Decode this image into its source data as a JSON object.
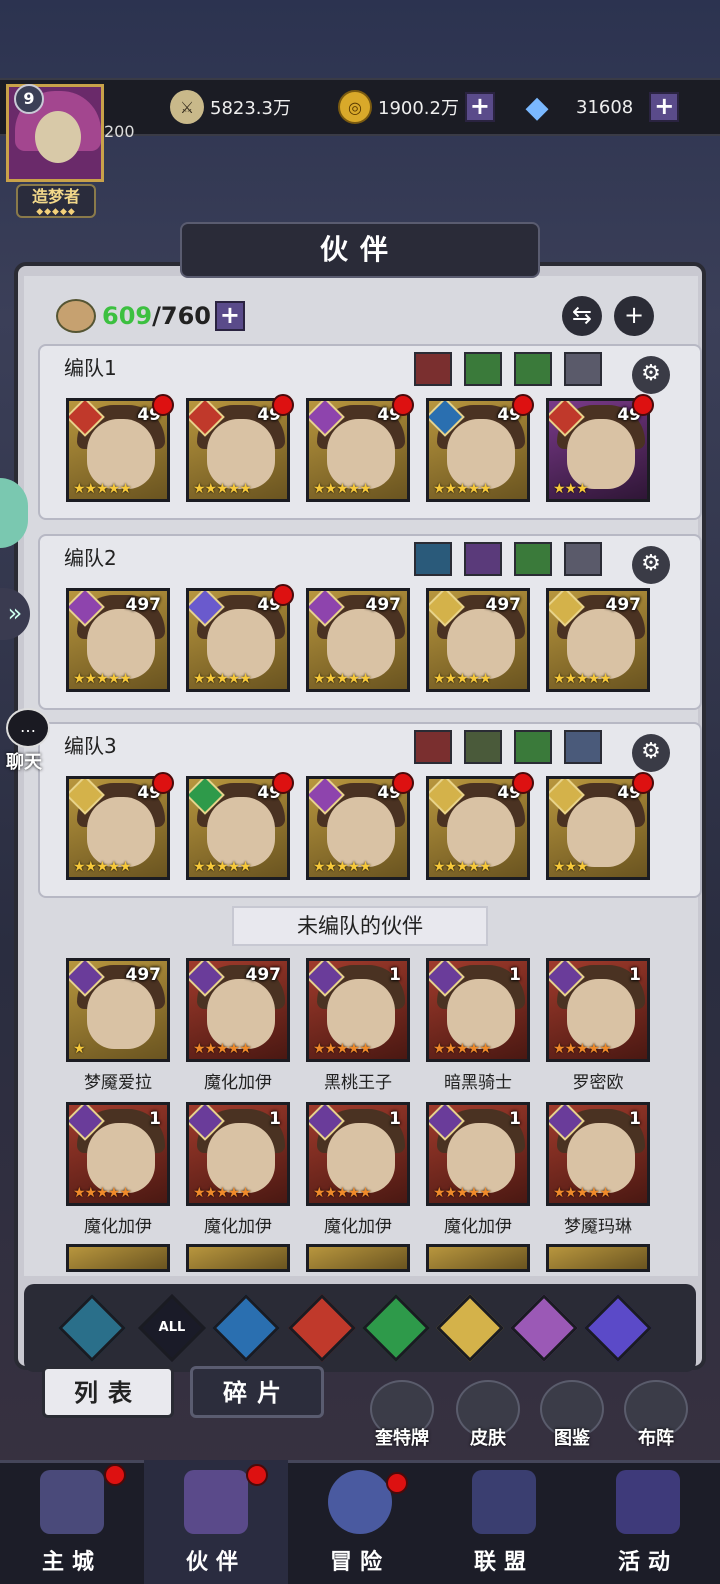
{
  "player": {
    "level": "9",
    "exp_level": "200",
    "rank": "造梦者",
    "rank_stars": "◆◆◆◆◆"
  },
  "resources": {
    "power": "5823.3万",
    "gold": "1900.2万",
    "diamonds": "31608"
  },
  "title": "伙伴",
  "capacity": {
    "current": "609",
    "max": "/760"
  },
  "teams": [
    {
      "name": "编队1",
      "heroes": [
        {
          "level": "49",
          "stars": "★★★★★",
          "frame": "gold",
          "elem_color": "#c0392b",
          "dot": true
        },
        {
          "level": "49",
          "stars": "★★★★★",
          "frame": "gold",
          "elem_color": "#c0392b",
          "dot": true
        },
        {
          "level": "49",
          "stars": "★★★★★",
          "frame": "gold",
          "elem_color": "#8e44ad",
          "dot": true
        },
        {
          "level": "49",
          "stars": "★★★★★",
          "frame": "gold",
          "elem_color": "#2a6fb0",
          "dot": true
        },
        {
          "level": "49",
          "stars": "★★★",
          "frame": "purple",
          "elem_color": "#c0392b",
          "dot": true
        }
      ]
    },
    {
      "name": "编队2",
      "heroes": [
        {
          "level": "497",
          "stars": "★★★★★",
          "frame": "gold",
          "elem_color": "#8e44ad",
          "dot": false
        },
        {
          "level": "49",
          "stars": "★★★★★",
          "frame": "gold",
          "elem_color": "#6a5acd",
          "dot": true
        },
        {
          "level": "497",
          "stars": "★★★★★",
          "frame": "gold",
          "elem_color": "#8e44ad",
          "dot": false
        },
        {
          "level": "497",
          "stars": "★★★★★",
          "frame": "gold",
          "elem_color": "#d4b24a",
          "dot": false
        },
        {
          "level": "497",
          "stars": "★★★★★",
          "frame": "gold",
          "elem_color": "#d4b24a",
          "dot": false
        }
      ]
    },
    {
      "name": "编队3",
      "heroes": [
        {
          "level": "49",
          "stars": "★★★★★",
          "frame": "gold",
          "elem_color": "#d4b24a",
          "dot": true
        },
        {
          "level": "49",
          "stars": "★★★★★",
          "frame": "gold",
          "elem_color": "#2e9a4a",
          "dot": true
        },
        {
          "level": "49",
          "stars": "★★★★★",
          "frame": "gold",
          "elem_color": "#8e44ad",
          "dot": true
        },
        {
          "level": "49",
          "stars": "★★★★★",
          "frame": "gold",
          "elem_color": "#d4b24a",
          "dot": true
        },
        {
          "level": "49",
          "stars": "★★★",
          "frame": "gold",
          "elem_color": "#d4b24a",
          "dot": true
        }
      ]
    }
  ],
  "unassigned_title": "未编队的伙伴",
  "unassigned": [
    {
      "name": "梦魇爱拉",
      "level": "497",
      "stars": "★",
      "frame": "gold",
      "star_color": "yellow"
    },
    {
      "name": "魔化加伊",
      "level": "497",
      "stars": "★★★★★",
      "frame": "red",
      "star_color": "orange"
    },
    {
      "name": "黑桃王子",
      "level": "1",
      "stars": "★★★★★",
      "frame": "red",
      "star_color": "orange"
    },
    {
      "name": "暗黑骑士",
      "level": "1",
      "stars": "★★★★★",
      "frame": "red",
      "star_color": "orange"
    },
    {
      "name": "罗密欧",
      "level": "1",
      "stars": "★★★★★",
      "frame": "red",
      "star_color": "orange"
    },
    {
      "name": "魔化加伊",
      "level": "1",
      "stars": "★★★★★",
      "frame": "red",
      "star_color": "orange"
    },
    {
      "name": "魔化加伊",
      "level": "1",
      "stars": "★★★★★",
      "frame": "red",
      "star_color": "orange"
    },
    {
      "name": "魔化加伊",
      "level": "1",
      "stars": "★★★★★",
      "frame": "red",
      "star_color": "orange"
    },
    {
      "name": "魔化加伊",
      "level": "1",
      "stars": "★★★★★",
      "frame": "red",
      "star_color": "orange"
    },
    {
      "name": "梦魇玛琳",
      "level": "1",
      "stars": "★★★★★",
      "frame": "red",
      "star_color": "orange"
    }
  ],
  "element_filters": [
    {
      "label": "",
      "color": "#2a6f8a"
    },
    {
      "label": "ALL",
      "color": "#1a1b28"
    },
    {
      "label": "",
      "color": "#2a6fb0"
    },
    {
      "label": "",
      "color": "#c0392b"
    },
    {
      "label": "",
      "color": "#2e9a4a"
    },
    {
      "label": "",
      "color": "#d4b24a"
    },
    {
      "label": "",
      "color": "#9b59b6"
    },
    {
      "label": "",
      "color": "#5b4ac8"
    }
  ],
  "tabs": {
    "list": "列表",
    "shards": "碎片"
  },
  "side_actions": {
    "tarot": "奎特牌",
    "skin": "皮肤",
    "codex": "图鉴",
    "formation": "布阵"
  },
  "chat": "聊天",
  "nav": {
    "city": "主城",
    "partner": "伙伴",
    "adventure": "冒险",
    "alliance": "联盟",
    "event": "活动"
  }
}
